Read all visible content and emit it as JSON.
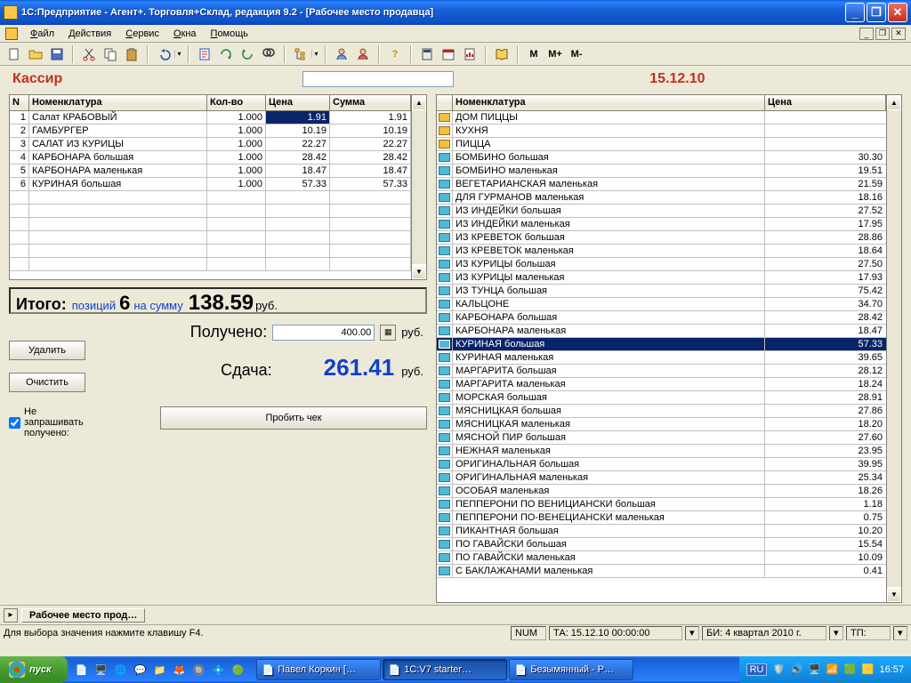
{
  "title": "1С:Предприятие - Агент+. Торговля+Склад, редакция 9.2 - [Рабочее место продавца]",
  "menu": {
    "file": "Файл",
    "actions": "Действия",
    "service": "Сервис",
    "windows": "Окна",
    "help": "Помощь"
  },
  "header": {
    "role": "Кассир",
    "date": "15.12.10"
  },
  "cartColumns": {
    "n": "N",
    "nom": "Номенклатура",
    "qty": "Кол-во",
    "price": "Цена",
    "sum": "Сумма"
  },
  "cart": [
    {
      "n": "1",
      "name": "Салат КРАБОВЫЙ",
      "qty": "1.000",
      "price": "1.91",
      "sum": "1.91"
    },
    {
      "n": "2",
      "name": "ГАМБУРГЕР",
      "qty": "1.000",
      "price": "10.19",
      "sum": "10.19"
    },
    {
      "n": "3",
      "name": "САЛАТ ИЗ КУРИЦЫ",
      "qty": "1.000",
      "price": "22.27",
      "sum": "22.27"
    },
    {
      "n": "4",
      "name": "КАРБОНАРА большая",
      "qty": "1.000",
      "price": "28.42",
      "sum": "28.42"
    },
    {
      "n": "5",
      "name": "КАРБОНАРА маленькая",
      "qty": "1.000",
      "price": "18.47",
      "sum": "18.47"
    },
    {
      "n": "6",
      "name": "КУРИНАЯ большая",
      "qty": "1.000",
      "price": "57.33",
      "sum": "57.33"
    }
  ],
  "summary": {
    "itogo": "Итого:",
    "poz": "позиций",
    "count": "6",
    "nasum": "на сумму",
    "total": "138.59",
    "rub": "руб."
  },
  "pay": {
    "received_label": "Получено:",
    "received": "400.00",
    "rub": "руб.",
    "change_label": "Сдача:",
    "change": "261.41",
    "delete": "Удалить",
    "clear": "Очистить",
    "ask": "Не запрашивать получено:",
    "receipt": "Пробить чек"
  },
  "catColumns": {
    "nom": "Номенклатура",
    "price": "Цена"
  },
  "catalog": [
    {
      "name": "ДОМ ПИЦЦЫ",
      "price": "",
      "t": "y"
    },
    {
      "name": "КУХНЯ",
      "price": "",
      "t": "y"
    },
    {
      "name": "ПИЦЦА",
      "price": "",
      "t": "y"
    },
    {
      "name": "БОМБИНО большая",
      "price": "30.30"
    },
    {
      "name": "БОМБИНО маленькая",
      "price": "19.51"
    },
    {
      "name": "ВЕГЕТАРИАНСКАЯ маленькая",
      "price": "21.59"
    },
    {
      "name": "ДЛЯ ГУРМАНОВ маленькая",
      "price": "18.16"
    },
    {
      "name": "ИЗ ИНДЕЙКИ большая",
      "price": "27.52"
    },
    {
      "name": "ИЗ ИНДЕЙКИ маленькая",
      "price": "17.95"
    },
    {
      "name": "ИЗ КРЕВЕТОК большая",
      "price": "28.86"
    },
    {
      "name": "ИЗ КРЕВЕТОК маленькая",
      "price": "18.64"
    },
    {
      "name": "ИЗ КУРИЦЫ большая",
      "price": "27.50"
    },
    {
      "name": "ИЗ КУРИЦЫ маленькая",
      "price": "17.93"
    },
    {
      "name": "ИЗ ТУНЦА большая",
      "price": "75.42"
    },
    {
      "name": "КАЛЬЦОНЕ",
      "price": "34.70"
    },
    {
      "name": "КАРБОНАРА большая",
      "price": "28.42"
    },
    {
      "name": "КАРБОНАРА маленькая",
      "price": "18.47"
    },
    {
      "name": "КУРИНАЯ большая",
      "price": "57.33",
      "sel": true
    },
    {
      "name": "КУРИНАЯ маленькая",
      "price": "39.65"
    },
    {
      "name": "МАРГАРИТА большая",
      "price": "28.12"
    },
    {
      "name": "МАРГАРИТА маленькая",
      "price": "18.24"
    },
    {
      "name": "МОРСКАЯ большая",
      "price": "28.91"
    },
    {
      "name": "МЯСНИЦКАЯ большая",
      "price": "27.86"
    },
    {
      "name": "МЯСНИЦКАЯ маленькая",
      "price": "18.20"
    },
    {
      "name": "МЯСНОЙ ПИР большая",
      "price": "27.60"
    },
    {
      "name": "НЕЖНАЯ маленькая",
      "price": "23.95"
    },
    {
      "name": "ОРИГИНАЛЬНАЯ большая",
      "price": "39.95"
    },
    {
      "name": "ОРИГИНАЛЬНАЯ маленькая",
      "price": "25.34"
    },
    {
      "name": "ОСОБАЯ маленькая",
      "price": "18.26"
    },
    {
      "name": "ПЕППЕРОНИ ПО ВЕНИЦИАНСКИ большая",
      "price": "1.18"
    },
    {
      "name": "ПЕППЕРОНИ ПО-ВЕНЕЦИАНСКИ маленькая",
      "price": "0.75"
    },
    {
      "name": "ПИКАНТНАЯ большая",
      "price": "10.20"
    },
    {
      "name": "ПО ГАВАЙСКИ большая",
      "price": "15.54"
    },
    {
      "name": "ПО ГАВАЙСКИ маленькая",
      "price": "10.09"
    },
    {
      "name": "С БАКЛАЖАНАМИ маленькая",
      "price": "0.41"
    }
  ],
  "tab": "Рабочее место прод…",
  "status": {
    "hint": "Для выбора значения нажмите клавишу F4.",
    "num": "NUM",
    "ta": "ТА: 15.12.10 00:00:00",
    "bi": "БИ: 4 квартал 2010 г.",
    "tp": "ТП:"
  },
  "taskbar": {
    "start": "пуск",
    "tasks": [
      {
        "label": "Павел Коркин […",
        "act": false
      },
      {
        "label": "1C:V7 starter…",
        "act": true
      },
      {
        "label": "Безымянный - P…",
        "act": false
      }
    ],
    "lang": "RU",
    "time": "16:57"
  }
}
